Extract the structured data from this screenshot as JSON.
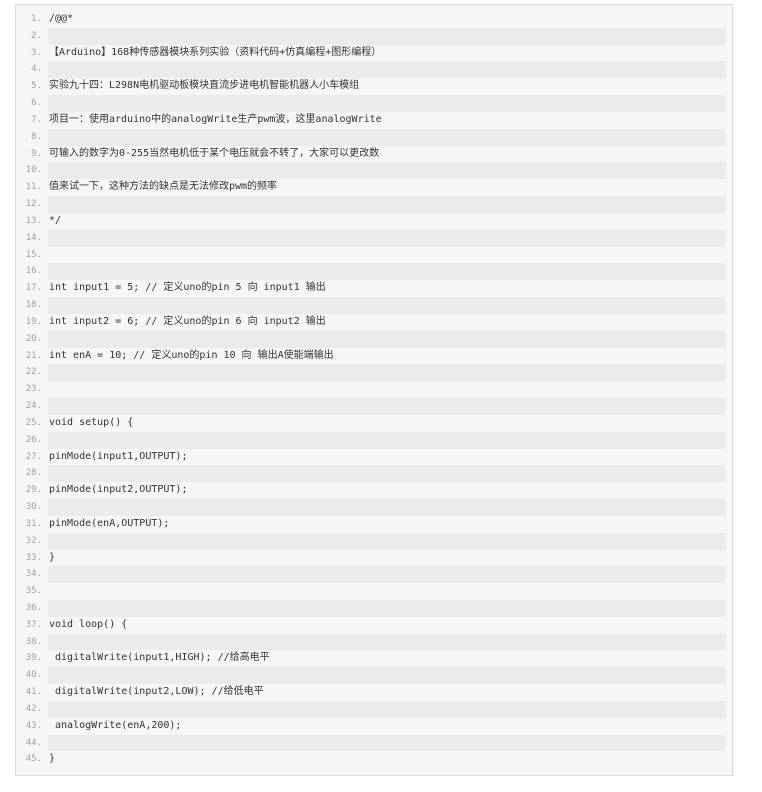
{
  "code": {
    "lines": [
      "/@@*",
      "",
      "【Arduino】168种传感器模块系列实验（资料代码+仿真编程+图形编程）",
      "",
      "实验九十四：L298N电机驱动板模块直流步进电机智能机器人小车模组",
      "",
      "项目一：使用arduino中的analogWrite生产pwm波，这里analogWrite",
      "",
      "可输入的数字为0-255当然电机低于某个电压就会不转了，大家可以更改数",
      "",
      "值来试一下，这种方法的缺点是无法修改pwm的频率",
      "",
      "*/",
      "",
      "",
      "",
      "int input1 = 5; // 定义uno的pin 5 向 input1 输出",
      "",
      "int input2 = 6; // 定义uno的pin 6 向 input2 输出",
      "",
      "int enA = 10; // 定义uno的pin 10 向 输出A使能端输出",
      "",
      "",
      "",
      "void setup() {",
      "",
      "pinMode(input1,OUTPUT);",
      "",
      "pinMode(input2,OUTPUT);",
      "",
      "pinMode(enA,OUTPUT);",
      "",
      "}",
      "",
      "",
      "",
      "void loop() {",
      "",
      " digitalWrite(input1,HIGH); //给高电平",
      "",
      " digitalWrite(input2,LOW); //给低电平",
      "",
      " analogWrite(enA,200);",
      "",
      "}"
    ]
  }
}
